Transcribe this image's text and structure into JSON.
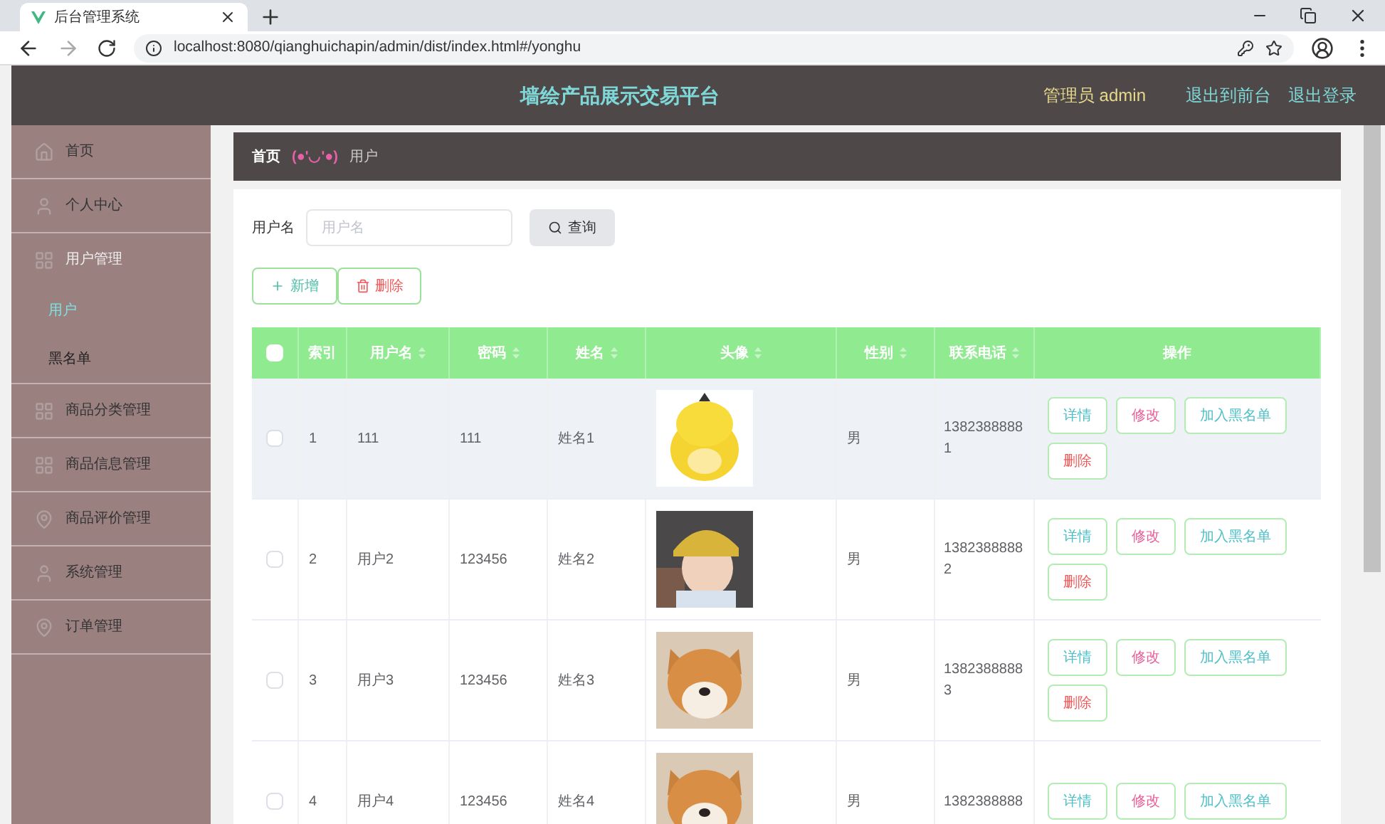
{
  "browser": {
    "tab_title": "后台管理系统",
    "url": "localhost:8080/qianghuichapin/admin/dist/index.html#/yonghu"
  },
  "header": {
    "title": "墙绘产品展示交易平台",
    "user_label": "管理员 admin",
    "links": [
      "退出到前台",
      "退出登录"
    ]
  },
  "sidebar": {
    "items": [
      {
        "label": "首页",
        "expanded": false
      },
      {
        "label": "个人中心",
        "expanded": false
      },
      {
        "label": "用户管理",
        "expanded": true,
        "children": [
          {
            "label": "用户",
            "selected": true
          },
          {
            "label": "黑名单",
            "selected": false
          }
        ]
      },
      {
        "label": "商品分类管理",
        "expanded": false
      },
      {
        "label": "商品信息管理",
        "expanded": false
      },
      {
        "label": "商品评价管理",
        "expanded": false
      },
      {
        "label": "系统管理",
        "expanded": false
      },
      {
        "label": "订单管理",
        "expanded": false
      }
    ]
  },
  "breadcrumb": {
    "home": "首页",
    "separator": "(●'◡'●)",
    "current": "用户"
  },
  "search": {
    "label": "用户名",
    "placeholder": "用户名",
    "button": "查询"
  },
  "actions": {
    "add": "新增",
    "delete": "删除"
  },
  "table": {
    "select_all_checked": false,
    "columns": [
      {
        "label": "索引",
        "sortable": false
      },
      {
        "label": "用户名",
        "sortable": true
      },
      {
        "label": "密码",
        "sortable": true
      },
      {
        "label": "姓名",
        "sortable": true
      },
      {
        "label": "头像",
        "sortable": true
      },
      {
        "label": "性别",
        "sortable": true
      },
      {
        "label": "联系电话",
        "sortable": true
      },
      {
        "label": "操作",
        "sortable": false
      }
    ],
    "rows": [
      {
        "checked": false,
        "highlighted": true,
        "index": "1",
        "username": "111",
        "password": "111",
        "name": "姓名1",
        "sex": "男",
        "phone": "13823888881",
        "actions": [
          {
            "label": "详情",
            "kind": "info"
          },
          {
            "label": "修改",
            "kind": "edit"
          },
          {
            "label": "加入黑名单",
            "kind": "info"
          },
          {
            "label": "删除",
            "kind": "danger"
          }
        ]
      },
      {
        "checked": false,
        "highlighted": false,
        "index": "2",
        "username": "用户2",
        "password": "123456",
        "name": "姓名2",
        "sex": "男",
        "phone": "13823888882",
        "actions": [
          {
            "label": "详情",
            "kind": "info"
          },
          {
            "label": "修改",
            "kind": "edit"
          },
          {
            "label": "加入黑名单",
            "kind": "info"
          },
          {
            "label": "删除",
            "kind": "danger"
          }
        ]
      },
      {
        "checked": false,
        "highlighted": false,
        "index": "3",
        "username": "用户3",
        "password": "123456",
        "name": "姓名3",
        "sex": "男",
        "phone": "13823888883",
        "actions": [
          {
            "label": "详情",
            "kind": "info"
          },
          {
            "label": "修改",
            "kind": "edit"
          },
          {
            "label": "加入黑名单",
            "kind": "info"
          },
          {
            "label": "删除",
            "kind": "danger"
          }
        ]
      },
      {
        "checked": false,
        "highlighted": false,
        "index": "4",
        "username": "用户4",
        "password": "123456",
        "name": "姓名4",
        "sex": "男",
        "phone": "1382388888",
        "actions": [
          {
            "label": "详情",
            "kind": "info"
          },
          {
            "label": "修改",
            "kind": "edit"
          },
          {
            "label": "加入黑名单",
            "kind": "info"
          }
        ]
      }
    ]
  }
}
